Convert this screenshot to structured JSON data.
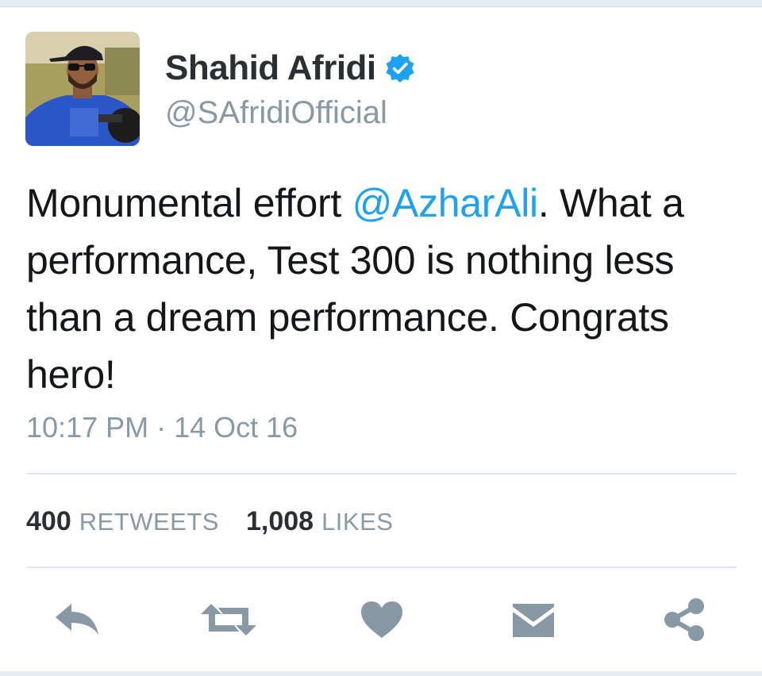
{
  "tweet": {
    "author": {
      "display_name": "Shahid Afridi",
      "handle": "@SAfridiOfficial",
      "verified": true
    },
    "text_parts": {
      "before": "Monumental effort ",
      "mention": "@AzharAli",
      "after": ". What a performance, Test 300 is nothing less than a dream performance. Congrats hero!"
    },
    "timestamp": "10:17 PM · 14 Oct 16",
    "stats": {
      "retweets_count": "400",
      "retweets_label": "RETWEETS",
      "likes_count": "1,008",
      "likes_label": "LIKES"
    }
  },
  "actions": [
    {
      "name": "reply",
      "icon": "reply-icon"
    },
    {
      "name": "retweet",
      "icon": "retweet-icon"
    },
    {
      "name": "like",
      "icon": "heart-icon"
    },
    {
      "name": "direct-message",
      "icon": "envelope-icon"
    },
    {
      "name": "share",
      "icon": "share-icon"
    }
  ],
  "colors": {
    "mention": "#1da1f2",
    "verified": "#1da1f2",
    "secondary_text": "#8899a6",
    "icon": "#8899a6"
  }
}
